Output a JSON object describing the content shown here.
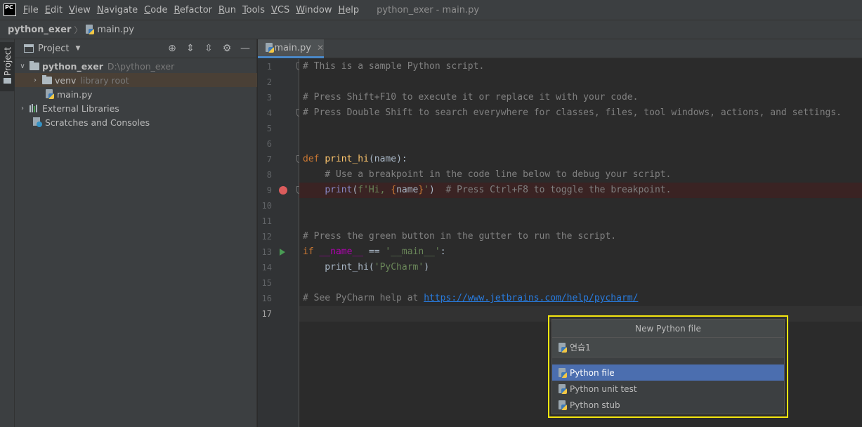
{
  "app": {
    "logo_text": "PC",
    "window_title": "python_exer - main.py"
  },
  "menu": [
    "File",
    "Edit",
    "View",
    "Navigate",
    "Code",
    "Refactor",
    "Run",
    "Tools",
    "VCS",
    "Window",
    "Help"
  ],
  "breadcrumb": {
    "project": "python_exer",
    "file": "main.py"
  },
  "toolstrip": {
    "project_tab": "Project"
  },
  "project_panel": {
    "title": "Project",
    "tree": {
      "root_name": "python_exer",
      "root_path": "D:\\python_exer",
      "venv_name": "venv",
      "venv_note": "library root",
      "main_file": "main.py",
      "external": "External Libraries",
      "scratches": "Scratches and Consoles"
    }
  },
  "editor": {
    "tab_label": "main.py",
    "line_numbers": [
      "1",
      "2",
      "3",
      "4",
      "5",
      "6",
      "7",
      "8",
      "9",
      "10",
      "11",
      "12",
      "13",
      "14",
      "15",
      "16",
      "17"
    ],
    "code": {
      "l1": "# This is a sample Python script.",
      "l3": "# Press Shift+F10 to execute it or replace it with your code.",
      "l4": "# Press Double Shift to search everywhere for classes, files, tool windows, actions, and settings.",
      "l7_kw": "def ",
      "l7_fn": "print_hi",
      "l7_rest": "(name):",
      "l8": "    # Use a breakpoint in the code line below to debug your script.",
      "l9_indent": "    ",
      "l9_builtin": "print",
      "l9_open": "(",
      "l9_str1": "f'Hi, ",
      "l9_brace_open": "{",
      "l9_name": "name",
      "l9_brace_close": "}",
      "l9_str2": "'",
      "l9_close": ")",
      "l9_comment": "  # Press Ctrl+F8 to toggle the breakpoint.",
      "l12": "# Press the green button in the gutter to run the script.",
      "l13_kw": "if ",
      "l13_dunder": "__name__",
      "l13_op": " == ",
      "l13_str": "'__main__'",
      "l13_colon": ":",
      "l14_call": "    print_hi(",
      "l14_str": "'PyCharm'",
      "l14_close": ")",
      "l16_comment": "# See PyCharm help at ",
      "l16_link": "https://www.jetbrains.com/help/pycharm/"
    }
  },
  "popup": {
    "title": "New Python file",
    "input_value": "연습1",
    "items": [
      "Python file",
      "Python unit test",
      "Python stub"
    ],
    "selected_index": 0
  },
  "colors": {
    "selection": "#4b6eaf",
    "highlight_border": "#f5e60f",
    "breakpoint": "#db5c5c",
    "run": "#499c54"
  }
}
